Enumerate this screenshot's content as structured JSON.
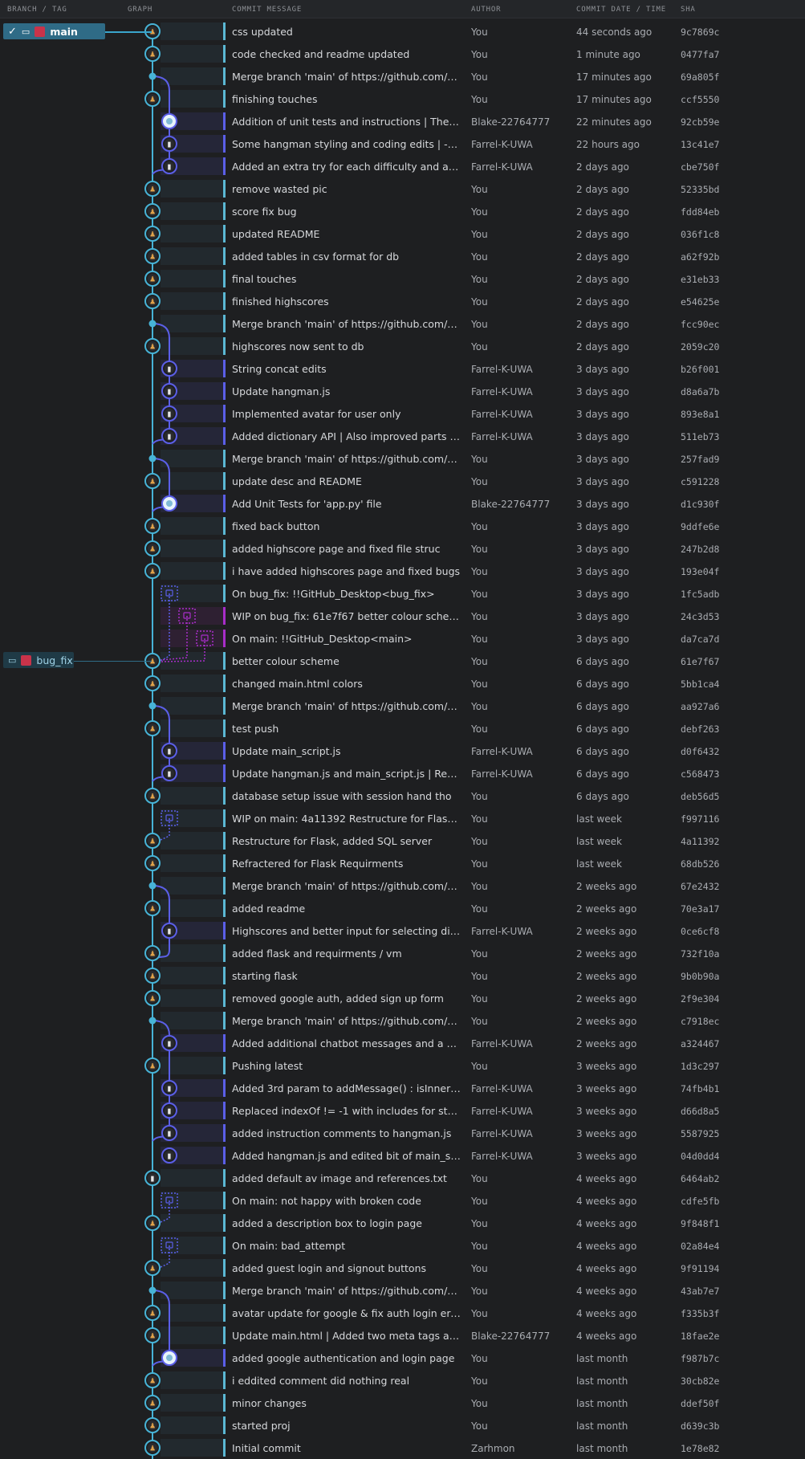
{
  "header": {
    "branch_tag": "BRANCH / TAG",
    "graph": "GRAPH",
    "commit_message": "COMMIT MESSAGE",
    "author": "AUTHOR",
    "date": "COMMIT DATE / TIME",
    "sha": "SHA"
  },
  "branches": {
    "main": "main",
    "bug_fix": "bug_fix"
  },
  "colors": {
    "main_lane": "#47b3d6",
    "side_lane": "#5b5fe8",
    "stash": "#a82dc9",
    "background": "#1e1f21"
  },
  "commits": [
    {
      "message": "css updated",
      "author": "You",
      "date": "44 seconds ago",
      "sha": "9c7869c"
    },
    {
      "message": "code checked and readme updated",
      "author": "You",
      "date": "1 minute ago",
      "sha": "0477fa7"
    },
    {
      "message": "Merge branch 'main' of https://github.com/Zar...",
      "author": "You",
      "date": "17 minutes ago",
      "sha": "69a805f"
    },
    {
      "message": "finishing touches",
      "author": "You",
      "date": "17 minutes ago",
      "sha": "ccf5550"
    },
    {
      "message": "Addition of unit tests and instructions | The com...",
      "author": "Blake-22764777",
      "date": "22 minutes ago",
      "sha": "92cb59e"
    },
    {
      "message": "Some hangman styling and coding edits | - cha...",
      "author": "Farrel-K-UWA",
      "date": "22 hours ago",
      "sha": "13c41e7"
    },
    {
      "message": "Added an extra try for each difficulty and added...",
      "author": "Farrel-K-UWA",
      "date": "2 days ago",
      "sha": "cbe750f"
    },
    {
      "message": "remove wasted pic",
      "author": "You",
      "date": "2 days ago",
      "sha": "52335bd"
    },
    {
      "message": "score fix bug",
      "author": "You",
      "date": "2 days ago",
      "sha": "fdd84eb"
    },
    {
      "message": "updated README",
      "author": "You",
      "date": "2 days ago",
      "sha": "036f1c8"
    },
    {
      "message": "added tables in csv format for db",
      "author": "You",
      "date": "2 days ago",
      "sha": "a62f92b"
    },
    {
      "message": "final touches",
      "author": "You",
      "date": "2 days ago",
      "sha": "e31eb33"
    },
    {
      "message": "finished highscores",
      "author": "You",
      "date": "2 days ago",
      "sha": "e54625e"
    },
    {
      "message": "Merge branch 'main' of https://github.com/Zar...",
      "author": "You",
      "date": "2 days ago",
      "sha": "fcc90ec"
    },
    {
      "message": "highscores now sent to db",
      "author": "You",
      "date": "2 days ago",
      "sha": "2059c20"
    },
    {
      "message": "String concat edits",
      "author": "Farrel-K-UWA",
      "date": "3 days ago",
      "sha": "b26f001"
    },
    {
      "message": "Update hangman.js",
      "author": "Farrel-K-UWA",
      "date": "3 days ago",
      "sha": "d8a6a7b"
    },
    {
      "message": "Implemented avatar for user only",
      "author": "Farrel-K-UWA",
      "date": "3 days ago",
      "sha": "893e8a1"
    },
    {
      "message": "Added dictionary API | Also improved parts of t...",
      "author": "Farrel-K-UWA",
      "date": "3 days ago",
      "sha": "511eb73"
    },
    {
      "message": "Merge branch 'main' of https://github.com/Zar...",
      "author": "You",
      "date": "3 days ago",
      "sha": "257fad9"
    },
    {
      "message": "update desc and README",
      "author": "You",
      "date": "3 days ago",
      "sha": "c591228"
    },
    {
      "message": "Add Unit Tests for 'app.py' file",
      "author": "Blake-22764777",
      "date": "3 days ago",
      "sha": "d1c930f"
    },
    {
      "message": "fixed back button",
      "author": "You",
      "date": "3 days ago",
      "sha": "9ddfe6e"
    },
    {
      "message": "added highscore page and fixed file struc",
      "author": "You",
      "date": "3 days ago",
      "sha": "247b2d8"
    },
    {
      "message": "i have added highscores page and fixed bugs",
      "author": "You",
      "date": "3 days ago",
      "sha": "193e04f"
    },
    {
      "message": "On bug_fix: !!GitHub_Desktop<bug_fix>",
      "author": "You",
      "date": "3 days ago",
      "sha": "1fc5adb"
    },
    {
      "message": "WIP on bug_fix: 61e7f67 better colour scheme",
      "author": "You",
      "date": "3 days ago",
      "sha": "24c3d53"
    },
    {
      "message": "On main: !!GitHub_Desktop<main>",
      "author": "You",
      "date": "3 days ago",
      "sha": "da7ca7d"
    },
    {
      "message": "better colour scheme",
      "author": "You",
      "date": "6 days ago",
      "sha": "61e7f67"
    },
    {
      "message": "changed main.html colors",
      "author": "You",
      "date": "6 days ago",
      "sha": "5bb1ca4"
    },
    {
      "message": "Merge branch 'main' of https://github.com/Zar...",
      "author": "You",
      "date": "6 days ago",
      "sha": "aa927a6"
    },
    {
      "message": "test push",
      "author": "You",
      "date": "6 days ago",
      "sha": "debf263"
    },
    {
      "message": "Update main_script.js",
      "author": "Farrel-K-UWA",
      "date": "6 days ago",
      "sha": "d0f6432"
    },
    {
      "message": "Update hangman.js and main_script.js | Replace...",
      "author": "Farrel-K-UWA",
      "date": "6 days ago",
      "sha": "c568473"
    },
    {
      "message": "database setup issue with session hand tho",
      "author": "You",
      "date": "6 days ago",
      "sha": "deb56d5"
    },
    {
      "message": "WIP on main: 4a11392 Restructure for Flask, ad...",
      "author": "You",
      "date": "last week",
      "sha": "f997116"
    },
    {
      "message": "Restructure for Flask, added SQL server",
      "author": "You",
      "date": "last week",
      "sha": "4a11392"
    },
    {
      "message": "Refractered for Flask Requirments",
      "author": "You",
      "date": "last week",
      "sha": "68db526"
    },
    {
      "message": "Merge branch 'main' of https://github.com/Zar...",
      "author": "You",
      "date": "2 weeks ago",
      "sha": "67e2432"
    },
    {
      "message": "added readme",
      "author": "You",
      "date": "2 weeks ago",
      "sha": "70e3a17"
    },
    {
      "message": "Highscores and better input for selecting difficu...",
      "author": "Farrel-K-UWA",
      "date": "2 weeks ago",
      "sha": "0ce6cf8"
    },
    {
      "message": "added flask and requirments / vm",
      "author": "You",
      "date": "2 weeks ago",
      "sha": "732f10a"
    },
    {
      "message": "starting flask",
      "author": "You",
      "date": "2 weeks ago",
      "sha": "9b0b90a"
    },
    {
      "message": "removed google auth, added sign up form",
      "author": "You",
      "date": "2 weeks ago",
      "sha": "2f9e304"
    },
    {
      "message": "Merge branch 'main' of https://github.com/Zar...",
      "author": "You",
      "date": "2 weeks ago",
      "sha": "c7918ec"
    },
    {
      "message": "Added additional chatbot messages and a score...",
      "author": "Farrel-K-UWA",
      "date": "2 weeks ago",
      "sha": "a324467"
    },
    {
      "message": "Pushing latest",
      "author": "You",
      "date": "3 weeks ago",
      "sha": "1d3c297"
    },
    {
      "message": "Added 3rd param to addMessage() : isInnerHT...",
      "author": "Farrel-K-UWA",
      "date": "3 weeks ago",
      "sha": "74fb4b1"
    },
    {
      "message": "Replaced indexOf != -1 with includes for strings",
      "author": "Farrel-K-UWA",
      "date": "3 weeks ago",
      "sha": "d66d8a5"
    },
    {
      "message": "added instruction comments to hangman.js",
      "author": "Farrel-K-UWA",
      "date": "3 weeks ago",
      "sha": "5587925"
    },
    {
      "message": "Added hangman.js and edited bit of main_script...",
      "author": "Farrel-K-UWA",
      "date": "3 weeks ago",
      "sha": "04d0dd4"
    },
    {
      "message": "added default av image and references.txt",
      "author": "You",
      "date": "4 weeks ago",
      "sha": "6464ab2"
    },
    {
      "message": "On main: not happy with broken code",
      "author": "You",
      "date": "4 weeks ago",
      "sha": "cdfe5fb"
    },
    {
      "message": "added a description box to login page",
      "author": "You",
      "date": "4 weeks ago",
      "sha": "9f848f1"
    },
    {
      "message": "On main: bad_attempt",
      "author": "You",
      "date": "4 weeks ago",
      "sha": "02a84e4"
    },
    {
      "message": "added guest login and signout buttons",
      "author": "You",
      "date": "4 weeks ago",
      "sha": "9f91194"
    },
    {
      "message": "Merge branch 'main' of https://github.com/Zar...",
      "author": "You",
      "date": "4 weeks ago",
      "sha": "43ab7e7"
    },
    {
      "message": "avatar update for google & fix auth login error",
      "author": "You",
      "date": "4 weeks ago",
      "sha": "f335b3f"
    },
    {
      "message": "Update main.html | Added two meta tags and la...",
      "author": "Blake-22764777",
      "date": "4 weeks ago",
      "sha": "18fae2e"
    },
    {
      "message": "added google authentication and login page",
      "author": "You",
      "date": "last month",
      "sha": "f987b7c"
    },
    {
      "message": "i eddited comment did nothing real",
      "author": "You",
      "date": "last month",
      "sha": "30cb82e"
    },
    {
      "message": "minor changes",
      "author": "You",
      "date": "last month",
      "sha": "ddef50f"
    },
    {
      "message": "started proj",
      "author": "You",
      "date": "last month",
      "sha": "d639c3b"
    },
    {
      "message": "Initial commit",
      "author": "Zarhmon",
      "date": "last month",
      "sha": "1e78e82"
    }
  ]
}
